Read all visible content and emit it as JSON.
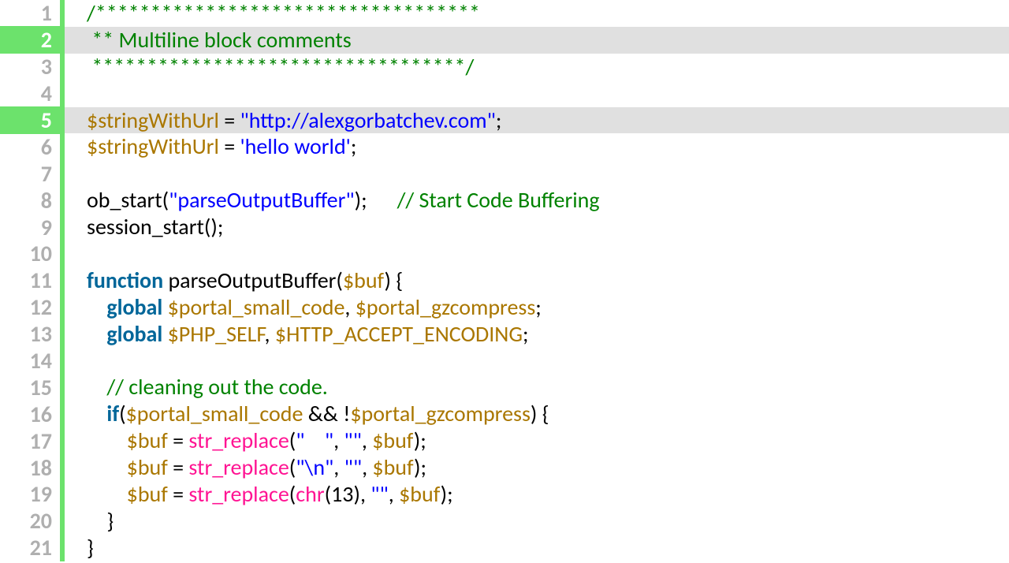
{
  "colors": {
    "highlight_bg": "#e0e0e0",
    "gutter_fg": "#afafaf",
    "gutter_highlight_bg": "#6ce26c",
    "rule": "#6ce26c",
    "comment": "#008200",
    "variable": "#aa7700",
    "plain": "#000000",
    "string": "#0000ff",
    "keyword": "#006699",
    "function": "#ff1493"
  },
  "highlighted_lines": [
    2,
    5
  ],
  "lines": [
    {
      "n": 1,
      "tokens": [
        {
          "t": "comment",
          "v": "/***********************************"
        }
      ]
    },
    {
      "n": 2,
      "tokens": [
        {
          "t": "comment",
          "v": " ** Multiline block comments"
        }
      ]
    },
    {
      "n": 3,
      "tokens": [
        {
          "t": "comment",
          "v": " **********************************/"
        }
      ]
    },
    {
      "n": 4,
      "tokens": []
    },
    {
      "n": 5,
      "tokens": [
        {
          "t": "variable",
          "v": "$stringWithUrl"
        },
        {
          "t": "plain",
          "v": " = "
        },
        {
          "t": "string",
          "v": "\"http://alexgorbatchev.com\""
        },
        {
          "t": "plain",
          "v": ";"
        }
      ]
    },
    {
      "n": 6,
      "tokens": [
        {
          "t": "variable",
          "v": "$stringWithUrl"
        },
        {
          "t": "plain",
          "v": " = "
        },
        {
          "t": "string",
          "v": "'hello world'"
        },
        {
          "t": "plain",
          "v": ";"
        }
      ]
    },
    {
      "n": 7,
      "tokens": []
    },
    {
      "n": 8,
      "tokens": [
        {
          "t": "plain",
          "v": "ob_start("
        },
        {
          "t": "string",
          "v": "\"parseOutputBuffer\""
        },
        {
          "t": "plain",
          "v": ");      "
        },
        {
          "t": "comment",
          "v": "// Start Code Buffering"
        }
      ]
    },
    {
      "n": 9,
      "tokens": [
        {
          "t": "plain",
          "v": "session_start();"
        }
      ]
    },
    {
      "n": 10,
      "tokens": []
    },
    {
      "n": 11,
      "tokens": [
        {
          "t": "keyword",
          "v": "function"
        },
        {
          "t": "plain",
          "v": " parseOutputBuffer("
        },
        {
          "t": "variable",
          "v": "$buf"
        },
        {
          "t": "plain",
          "v": ") {"
        }
      ]
    },
    {
      "n": 12,
      "tokens": [
        {
          "t": "plain",
          "v": "    "
        },
        {
          "t": "keyword",
          "v": "global"
        },
        {
          "t": "plain",
          "v": " "
        },
        {
          "t": "variable",
          "v": "$portal_small_code"
        },
        {
          "t": "plain",
          "v": ", "
        },
        {
          "t": "variable",
          "v": "$portal_gzcompress"
        },
        {
          "t": "plain",
          "v": ";"
        }
      ]
    },
    {
      "n": 13,
      "tokens": [
        {
          "t": "plain",
          "v": "    "
        },
        {
          "t": "keyword",
          "v": "global"
        },
        {
          "t": "plain",
          "v": " "
        },
        {
          "t": "variable",
          "v": "$PHP_SELF"
        },
        {
          "t": "plain",
          "v": ", "
        },
        {
          "t": "variable",
          "v": "$HTTP_ACCEPT_ENCODING"
        },
        {
          "t": "plain",
          "v": ";"
        }
      ]
    },
    {
      "n": 14,
      "tokens": []
    },
    {
      "n": 15,
      "tokens": [
        {
          "t": "plain",
          "v": "    "
        },
        {
          "t": "comment",
          "v": "// cleaning out the code."
        }
      ]
    },
    {
      "n": 16,
      "tokens": [
        {
          "t": "plain",
          "v": "    "
        },
        {
          "t": "keyword",
          "v": "if"
        },
        {
          "t": "plain",
          "v": "("
        },
        {
          "t": "variable",
          "v": "$portal_small_code"
        },
        {
          "t": "plain",
          "v": " && !"
        },
        {
          "t": "variable",
          "v": "$portal_gzcompress"
        },
        {
          "t": "plain",
          "v": ") {"
        }
      ]
    },
    {
      "n": 17,
      "tokens": [
        {
          "t": "plain",
          "v": "        "
        },
        {
          "t": "variable",
          "v": "$buf"
        },
        {
          "t": "plain",
          "v": " = "
        },
        {
          "t": "function",
          "v": "str_replace"
        },
        {
          "t": "plain",
          "v": "("
        },
        {
          "t": "string",
          "v": "\"    \""
        },
        {
          "t": "plain",
          "v": ", "
        },
        {
          "t": "string",
          "v": "\"\""
        },
        {
          "t": "plain",
          "v": ", "
        },
        {
          "t": "variable",
          "v": "$buf"
        },
        {
          "t": "plain",
          "v": ");"
        }
      ]
    },
    {
      "n": 18,
      "tokens": [
        {
          "t": "plain",
          "v": "        "
        },
        {
          "t": "variable",
          "v": "$buf"
        },
        {
          "t": "plain",
          "v": " = "
        },
        {
          "t": "function",
          "v": "str_replace"
        },
        {
          "t": "plain",
          "v": "("
        },
        {
          "t": "string",
          "v": "\"\\n\""
        },
        {
          "t": "plain",
          "v": ", "
        },
        {
          "t": "string",
          "v": "\"\""
        },
        {
          "t": "plain",
          "v": ", "
        },
        {
          "t": "variable",
          "v": "$buf"
        },
        {
          "t": "plain",
          "v": ");"
        }
      ]
    },
    {
      "n": 19,
      "tokens": [
        {
          "t": "plain",
          "v": "        "
        },
        {
          "t": "variable",
          "v": "$buf"
        },
        {
          "t": "plain",
          "v": " = "
        },
        {
          "t": "function",
          "v": "str_replace"
        },
        {
          "t": "plain",
          "v": "("
        },
        {
          "t": "function",
          "v": "chr"
        },
        {
          "t": "plain",
          "v": "(13), "
        },
        {
          "t": "string",
          "v": "\"\""
        },
        {
          "t": "plain",
          "v": ", "
        },
        {
          "t": "variable",
          "v": "$buf"
        },
        {
          "t": "plain",
          "v": ");"
        }
      ]
    },
    {
      "n": 20,
      "tokens": [
        {
          "t": "plain",
          "v": "    }"
        }
      ]
    },
    {
      "n": 21,
      "tokens": [
        {
          "t": "plain",
          "v": "}"
        }
      ]
    }
  ]
}
